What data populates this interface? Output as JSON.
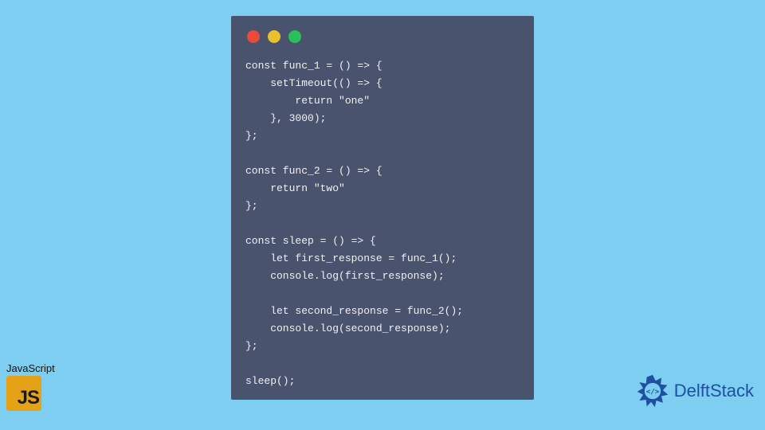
{
  "code": {
    "lines": [
      "const func_1 = () => {",
      "    setTimeout(() => {",
      "        return \"one\"",
      "    }, 3000);",
      "};",
      "",
      "const func_2 = () => {",
      "    return \"two\"",
      "};",
      "",
      "const sleep = () => {",
      "    let first_response = func_1();",
      "    console.log(first_response);",
      "",
      "    let second_response = func_2();",
      "    console.log(second_response);",
      "};",
      "",
      "sleep();"
    ]
  },
  "window": {
    "dot_colors": [
      "#e84b3c",
      "#e8c22e",
      "#2bbf59"
    ]
  },
  "badge": {
    "label": "JavaScript",
    "abbrev": "JS"
  },
  "brand": {
    "name": "DelftStack"
  }
}
